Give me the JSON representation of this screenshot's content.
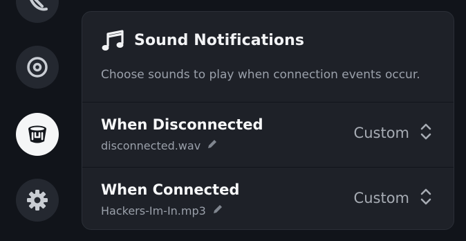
{
  "sidebar": {
    "items": [
      {
        "icon": "satellite-icon"
      },
      {
        "icon": "disc-icon"
      },
      {
        "icon": "bucket-icon",
        "active": true
      },
      {
        "icon": "gear-icon"
      }
    ]
  },
  "panel": {
    "title": "Sound Notifications",
    "subtitle": "Choose sounds to play when connection events occur.",
    "rows": [
      {
        "title": "When Disconnected",
        "file": "disconnected.wav",
        "value": "Custom"
      },
      {
        "title": "When Connected",
        "file": "Hackers-Im-In.mp3",
        "value": "Custom"
      }
    ]
  },
  "colors": {
    "background": "#11141a",
    "panel": "#1e2128",
    "active_button": "#f5f6f7",
    "button": "#242830"
  }
}
